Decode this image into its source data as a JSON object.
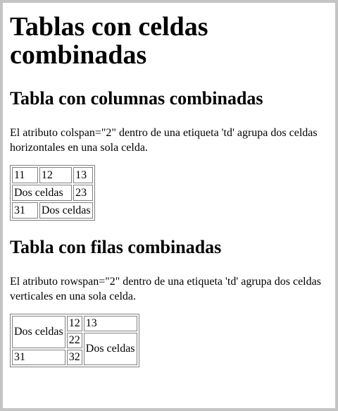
{
  "title": "Tablas con celdas combinadas",
  "section1": {
    "heading": "Tabla con columnas combinadas",
    "description": "El atributo colspan=\"2\" dentro de una etiqueta 'td' agrupa dos celdas horizontales en una sola celda.",
    "rows": [
      [
        "11",
        "12",
        "13"
      ],
      [
        "Dos celdas",
        "23"
      ],
      [
        "31",
        "Dos celdas"
      ]
    ]
  },
  "section2": {
    "heading": "Tabla con filas combinadas",
    "description": "El atributo rowspan=\"2\" dentro de una etiqueta 'td' agrupa dos celdas verticales en una sola celda.",
    "cells": {
      "r1_merged": "Dos celdas",
      "r1_c2": "12",
      "r1_c3": "13",
      "r2_c2": "22",
      "r2_merged": "Dos celdas",
      "r3_c1": "31",
      "r3_c2": "32"
    }
  }
}
